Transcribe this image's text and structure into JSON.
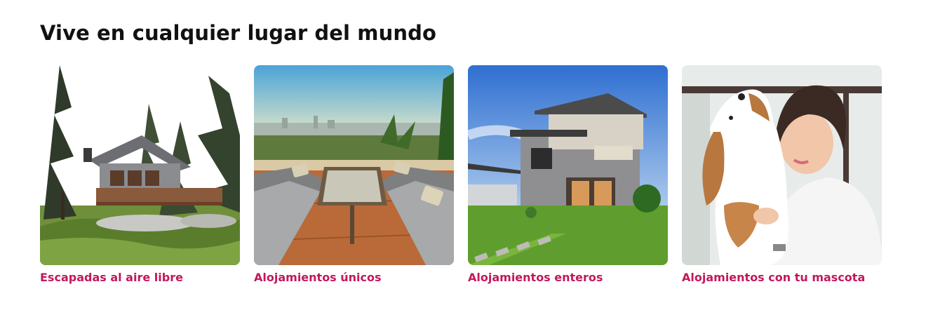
{
  "section": {
    "title": "Vive en cualquier lugar del mundo",
    "accent_color": "#c2185b",
    "cards": [
      {
        "label": "Escapadas al aire libre",
        "image": "cabin-in-forest"
      },
      {
        "label": "Alojamientos únicos",
        "image": "rooftop-terrace-sofas"
      },
      {
        "label": "Alojamientos enteros",
        "image": "modern-two-story-house"
      },
      {
        "label": "Alojamientos con tu mascota",
        "image": "woman-hugging-beagle"
      }
    ]
  }
}
